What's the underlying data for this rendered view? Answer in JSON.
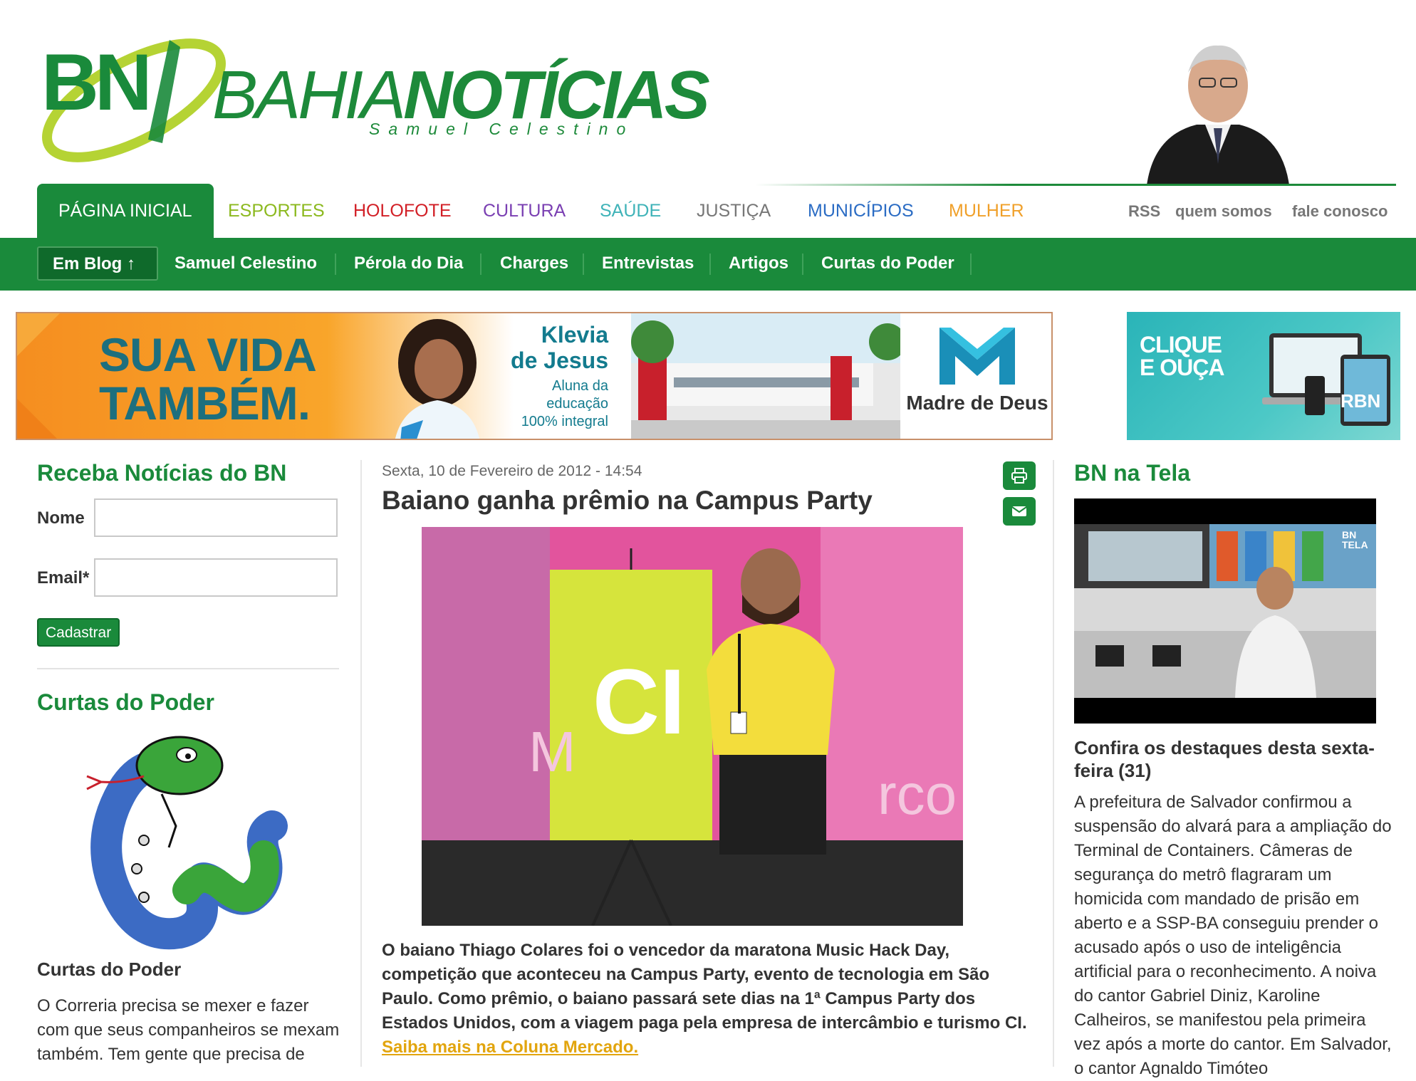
{
  "brand": {
    "logo_initials": "BN",
    "logo_word_thin": "BAHIA",
    "logo_word_bold": "NOTÍCIAS",
    "logo_subtitle": "Samuel Celestino",
    "green": "#1a8a3b",
    "accent_lime": "#b5d334"
  },
  "topnav": {
    "tabs": [
      {
        "label": "PÁGINA INICIAL",
        "color": "#ffffff",
        "active": true
      },
      {
        "label": "ESPORTES",
        "color": "#8cb91f"
      },
      {
        "label": "HOLOFOTE",
        "color": "#d21f26"
      },
      {
        "label": "CULTURA",
        "color": "#7a3fb2"
      },
      {
        "label": "SAÚDE",
        "color": "#3fb3b8"
      },
      {
        "label": "JUSTIÇA",
        "color": "#777777"
      },
      {
        "label": "MUNICÍPIOS",
        "color": "#2b6cc4"
      },
      {
        "label": "MULHER",
        "color": "#f0a02a"
      }
    ],
    "links": [
      "RSS",
      "quem somos",
      "fale conosco"
    ]
  },
  "subnav": {
    "em_blog": "Em Blog ↑",
    "items": [
      "Samuel Celestino",
      "Pérola do Dia",
      "Charges",
      "Entrevistas",
      "Artigos",
      "Curtas do Poder"
    ]
  },
  "banner_main": {
    "headline_line1": "SUA VIDA",
    "headline_line2": "TAMBÉM.",
    "name_line1": "Klevia",
    "name_line2": "de Jesus",
    "sub_line1": "Aluna da",
    "sub_line2": "educação",
    "sub_line3": "100% integral",
    "logo_name": "Madre de Deus"
  },
  "banner_side": {
    "line1": "CLIQUE",
    "line2": "E OUÇA",
    "logo": "RBN"
  },
  "newsletter": {
    "title": "Receba Notícias do BN",
    "name_label": "Nome",
    "email_label": "Email*",
    "name_value": "",
    "email_value": "",
    "button": "Cadastrar"
  },
  "curtas": {
    "title": "Curtas do Poder",
    "subtitle": "Curtas do Poder",
    "text": "O Correria precisa se mexer e fazer com que seus companheiros se mexam também. Tem gente que precisa de"
  },
  "article": {
    "date": "Sexta, 10 de Fevereiro de 2012 - 14:54",
    "title": "Baiano ganha prêmio na Campus Party",
    "body": "O baiano Thiago Colares foi o vencedor da maratona Music Hack Day, competição que aconteceu na Campus Party, evento de tecnologia em São Paulo. Como prêmio, o baiano passará sete dias na 1ª Campus Party dos Estados Unidos, com a viagem paga pela empresa de intercâmbio e turismo CI.",
    "link": "Saiba mais na Coluna Mercado.",
    "photo_banner_text": "CI",
    "photo_bg_text": "rco",
    "photo_letter": "M"
  },
  "right": {
    "title": "BN na Tela",
    "video_badge": "BN TELA",
    "subtitle": "Confira os destaques desta sexta-feira (31)",
    "text": "A prefeitura de Salvador confirmou a suspensão do alvará para a ampliação do Terminal de Containers. Câmeras de segurança do metrô flagraram um homicida com mandado de prisão em aberto e a SSP-BA conseguiu prender o acusado após o uso de inteligência artificial para o reconhecimento. A noiva do cantor Gabriel Diniz, Karoline Calheiros, se manifestou pela primeira vez após a morte do cantor. Em Salvador, o cantor Agnaldo Timóteo"
  }
}
